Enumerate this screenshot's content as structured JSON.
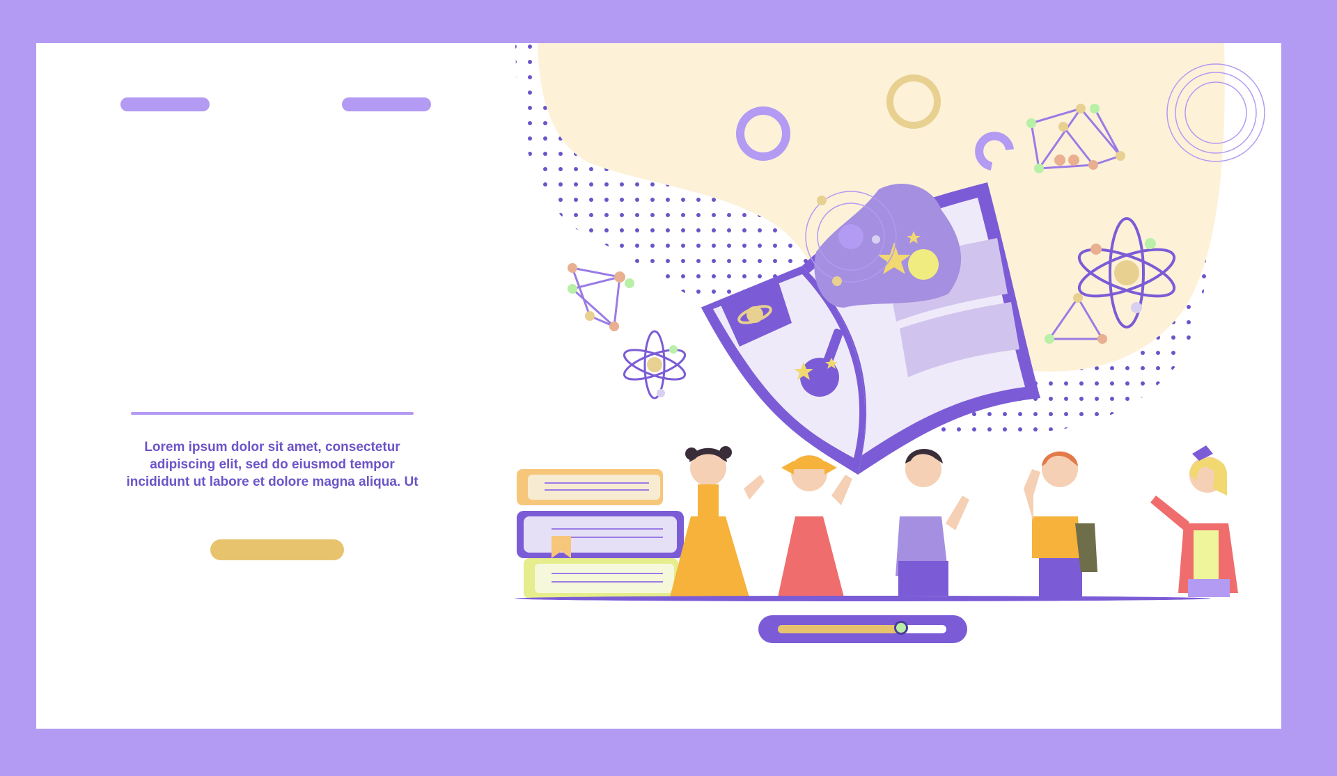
{
  "colors": {
    "frame": "#b39af2",
    "card": "#ffffff",
    "accent_purple": "#7b5cd6",
    "lavender": "#b39af2",
    "nav_pill": "#b39af2",
    "cta": "#e8c36e",
    "blob": "#fdf1d8",
    "text": "#6c54c8",
    "progress_fill": "#e8c36e",
    "progress_knob": "#b8f0a8"
  },
  "nav": {
    "items": [
      "nav-link-1",
      "nav-link-2",
      "nav-link-3"
    ]
  },
  "hero": {
    "body_text": "Lorem ipsum dolor sit amet, consectetur adipiscing elit, sed do eiusmod tempor incididunt ut labore et dolore magna aliqua. Ut",
    "cta_label": ""
  },
  "progress": {
    "value": 0.73
  },
  "illustration": {
    "icons": [
      "open-book-icon",
      "flask-icon",
      "planet-icon",
      "atom-icon",
      "molecule-icon",
      "stacked-books-icon",
      "children-group-icon",
      "star-icon",
      "ring-icon"
    ]
  }
}
